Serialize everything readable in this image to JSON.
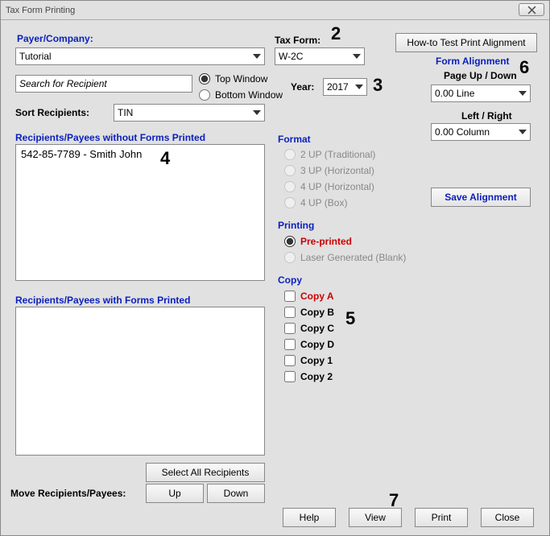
{
  "window": {
    "title": "Tax Form Printing"
  },
  "payer_label": "Payer/Company:",
  "payer_value": "Tutorial",
  "search_placeholder": "Search for Recipient",
  "top_window": "Top Window",
  "bottom_window": "Bottom Window",
  "sort_label": "Sort Recipients:",
  "sort_value": "TIN",
  "list_without_label": "Recipients/Payees without Forms Printed",
  "list_without_item": "542-85-7789 - Smith John",
  "list_with_label": "Recipients/Payees with Forms Printed",
  "select_all": "Select All Recipients",
  "move_label": "Move Recipients/Payees:",
  "btn_up": "Up",
  "btn_down": "Down",
  "tax_form_label": "Tax Form:",
  "tax_form_value": "W-2C",
  "year_label": "Year:",
  "year_value": "2017",
  "howto_btn": "How-to Test Print  Alignment",
  "form_alignment": "Form Alignment",
  "page_up_down": "Page Up / Down",
  "line_value": "0.00 Line",
  "left_right": "Left / Right",
  "col_value": "0.00 Column",
  "save_alignment": "Save  Alignment",
  "format_label": "Format",
  "format_opts": {
    "a": "2 UP (Traditional)",
    "b": "3 UP (Horizontal)",
    "c": "4 UP (Horizontal)",
    "d": "4 UP (Box)"
  },
  "printing_label": "Printing",
  "printing_pre": "Pre-printed",
  "printing_laser": "Laser Generated (Blank)",
  "copy_label": "Copy",
  "copy_a": "Copy A",
  "copy_b": "Copy B",
  "copy_c": "Copy C",
  "copy_d": "Copy D",
  "copy_1": "Copy 1",
  "copy_2": "Copy 2",
  "btn_help": "Help",
  "btn_view": "View",
  "btn_print": "Print",
  "btn_close": "Close",
  "callouts": {
    "c2": "2",
    "c3": "3",
    "c4": "4",
    "c5": "5",
    "c6": "6",
    "c7": "7"
  }
}
